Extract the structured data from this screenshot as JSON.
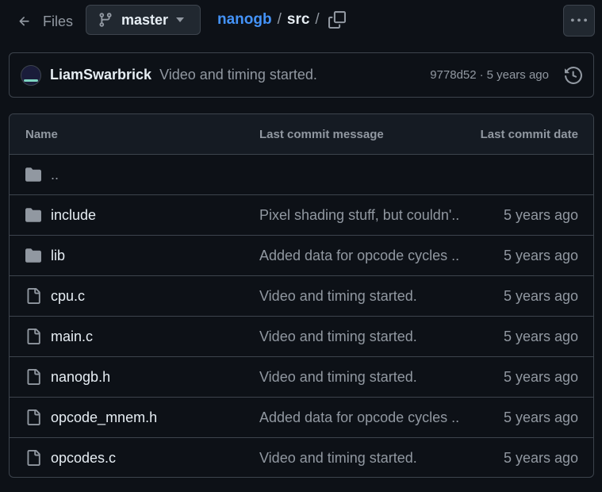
{
  "header": {
    "files_label": "Files",
    "branch": "master",
    "breadcrumb": {
      "repo": "nanogb",
      "sep1": "/",
      "folder": "src",
      "sep2": "/"
    }
  },
  "latest_commit": {
    "author": "LiamSwarbrick",
    "message": "Video and timing started.",
    "sha": "9778d52",
    "dot": "·",
    "time": "5 years ago"
  },
  "table": {
    "headers": {
      "name": "Name",
      "message": "Last commit message",
      "date": "Last commit date"
    },
    "parent": "..",
    "rows": [
      {
        "name": "include",
        "type": "folder",
        "message": "Pixel shading stuff, but couldn'...",
        "date": "5 years ago"
      },
      {
        "name": "lib",
        "type": "folder",
        "message": "Added data for opcode cycles ...",
        "date": "5 years ago"
      },
      {
        "name": "cpu.c",
        "type": "file",
        "message": "Video and timing started.",
        "date": "5 years ago"
      },
      {
        "name": "main.c",
        "type": "file",
        "message": "Video and timing started.",
        "date": "5 years ago"
      },
      {
        "name": "nanogb.h",
        "type": "file",
        "message": "Video and timing started.",
        "date": "5 years ago"
      },
      {
        "name": "opcode_mnem.h",
        "type": "file",
        "message": "Added data for opcode cycles ...",
        "date": "5 years ago"
      },
      {
        "name": "opcodes.c",
        "type": "file",
        "message": "Video and timing started.",
        "date": "5 years ago"
      }
    ]
  },
  "colors": {
    "background": "#0d1117",
    "border": "#3d444d",
    "link": "#4493f8",
    "muted": "#9198a1",
    "text": "#e6edf3"
  }
}
